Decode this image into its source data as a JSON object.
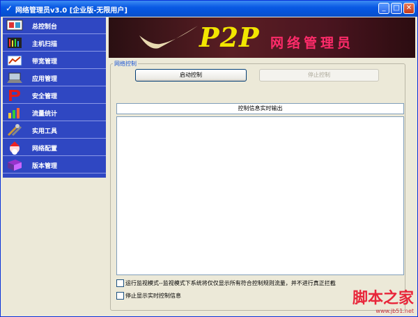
{
  "window": {
    "title": "网络管理员v3.0  [企业版-无限用户]",
    "icon": "checkmark-app-icon",
    "controls": [
      "minimize-icon",
      "maximize-icon",
      "close-icon"
    ]
  },
  "sidebar": {
    "items": [
      {
        "label": "总控制台",
        "icon": "console-icon"
      },
      {
        "label": "主机扫描",
        "icon": "host-scan-icon"
      },
      {
        "label": "带宽管理",
        "icon": "bandwidth-icon"
      },
      {
        "label": "应用管理",
        "icon": "laptop-icon"
      },
      {
        "label": "安全管理",
        "icon": "security-p-icon"
      },
      {
        "label": "流量统计",
        "icon": "chart-icon"
      },
      {
        "label": "实用工具",
        "icon": "tools-icon"
      },
      {
        "label": "网络配置",
        "icon": "santa-icon"
      },
      {
        "label": "版本管理",
        "icon": "book-icon"
      }
    ]
  },
  "banner": {
    "logo": "P2P",
    "subtitle": "网络管理员"
  },
  "control": {
    "group_title": "网络控制",
    "start_label": "启动控制",
    "stop_label": "停止控制",
    "output_header": "控制信息实时输出"
  },
  "options": {
    "monitor_label": "运行监视模式--监视模式下系统将仅仅显示所有符合控制规则流量，并不进行真正拦截",
    "stop_display_label": "停止显示实时控制信息"
  },
  "watermark": {
    "text": "脚本之家",
    "url": "www.jb51.net"
  }
}
